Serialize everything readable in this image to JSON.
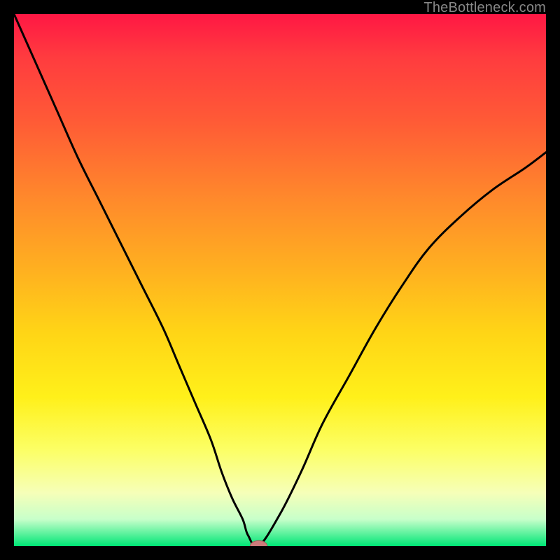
{
  "watermark": "TheBottleneck.com",
  "colors": {
    "frame": "#000000",
    "curve": "#000000",
    "marker_fill": "#cc7a7a",
    "marker_stroke": "#a35a5a"
  },
  "chart_data": {
    "type": "line",
    "title": "",
    "xlabel": "",
    "ylabel": "",
    "xlim": [
      0,
      100
    ],
    "ylim": [
      0,
      100
    ],
    "grid": false,
    "legend": null,
    "series": [
      {
        "name": "bottleneck-curve",
        "x": [
          0,
          4,
          8,
          12,
          16,
          20,
          24,
          28,
          31,
          34,
          37,
          39,
          41,
          43,
          44,
          46,
          50,
          54,
          58,
          63,
          68,
          73,
          78,
          84,
          90,
          96,
          100
        ],
        "y": [
          100,
          91,
          82,
          73,
          65,
          57,
          49,
          41,
          34,
          27,
          20,
          14,
          9,
          5,
          2,
          0,
          6,
          14,
          23,
          32,
          41,
          49,
          56,
          62,
          67,
          71,
          74
        ]
      }
    ],
    "marker": {
      "x": 46,
      "y": 0,
      "rx": 1.6,
      "ry": 1.0
    },
    "background_gradient_stops": [
      {
        "pos": 0,
        "color": "#ff1744"
      },
      {
        "pos": 8,
        "color": "#ff3b3f"
      },
      {
        "pos": 20,
        "color": "#ff5a36"
      },
      {
        "pos": 35,
        "color": "#ff8a2b"
      },
      {
        "pos": 48,
        "color": "#ffb020"
      },
      {
        "pos": 60,
        "color": "#ffd516"
      },
      {
        "pos": 72,
        "color": "#fff01a"
      },
      {
        "pos": 82,
        "color": "#fcff66"
      },
      {
        "pos": 90,
        "color": "#f6ffb8"
      },
      {
        "pos": 95,
        "color": "#c7ffca"
      },
      {
        "pos": 100,
        "color": "#00e676"
      }
    ]
  }
}
